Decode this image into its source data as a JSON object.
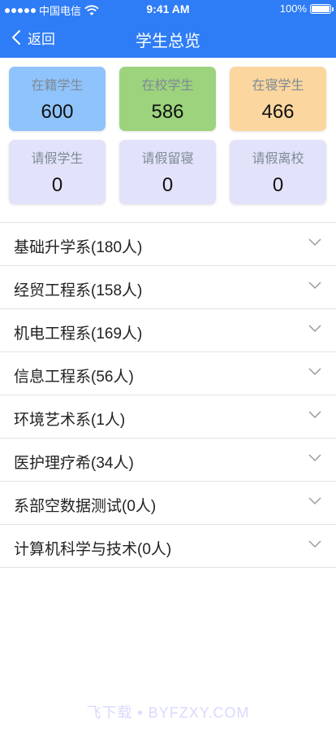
{
  "status_bar": {
    "carrier": "中国电信",
    "time": "9:41 AM",
    "battery": "100%",
    "battery_level": 1.0,
    "signal_dots": 5
  },
  "nav": {
    "back_label": "返回",
    "title": "学生总览"
  },
  "stats": [
    {
      "label": "在籍学生",
      "value": "600",
      "color": "#8fc3fb"
    },
    {
      "label": "在校学生",
      "value": "586",
      "color": "#9cd37c"
    },
    {
      "label": "在寝学生",
      "value": "466",
      "color": "#fbd69e"
    },
    {
      "label": "请假学生",
      "value": "0",
      "color": "#e2e3fa"
    },
    {
      "label": "请假留寝",
      "value": "0",
      "color": "#e2e3fa"
    },
    {
      "label": "请假离校",
      "value": "0",
      "color": "#e2e3fa"
    }
  ],
  "departments": [
    {
      "name": "基础升学系(180人)"
    },
    {
      "name": "经贸工程系(158人)"
    },
    {
      "name": "机电工程系(169人)"
    },
    {
      "name": "信息工程系(56人)"
    },
    {
      "name": "环境艺术系(1人)"
    },
    {
      "name": "医护理疗希(34人)"
    },
    {
      "name": "系部空数据测试(0人)"
    },
    {
      "name": "计算机科学与技术(0人)"
    }
  ],
  "watermark": "飞下载 • BYFZXY.COM",
  "colors": {
    "header": "#2e7cf6",
    "divider": "#e3e3e3"
  }
}
